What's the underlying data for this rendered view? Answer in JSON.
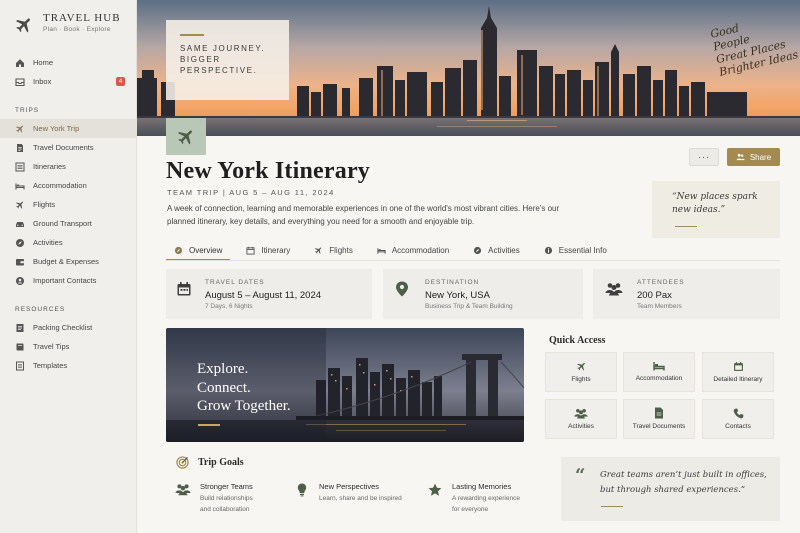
{
  "brand": {
    "title": "TRAVEL HUB",
    "subtitle": "Plan  ·  Book  ·  Explore"
  },
  "sidebar": {
    "top_items": [
      {
        "label": "Home",
        "icon": "home-icon"
      },
      {
        "label": "Inbox",
        "icon": "inbox-icon",
        "badge": "4"
      }
    ],
    "trips_label": "TRIPS",
    "trip_items": [
      {
        "label": "New York Trip",
        "icon": "plane-icon",
        "active": true
      },
      {
        "label": "Travel Documents",
        "icon": "document-icon"
      },
      {
        "label": "Itineraries",
        "icon": "list-icon"
      },
      {
        "label": "Accommodation",
        "icon": "bed-icon"
      },
      {
        "label": "Flights",
        "icon": "plane-icon"
      },
      {
        "label": "Ground Transport",
        "icon": "car-icon"
      },
      {
        "label": "Activities",
        "icon": "compass-icon"
      },
      {
        "label": "Budget & Expenses",
        "icon": "wallet-icon"
      },
      {
        "label": "Important Contacts",
        "icon": "person-icon"
      }
    ],
    "resources_label": "RESOURCES",
    "resource_items": [
      {
        "label": "Packing Checklist",
        "icon": "checklist-icon"
      },
      {
        "label": "Travel Tips",
        "icon": "book-icon"
      },
      {
        "label": "Templates",
        "icon": "template-icon"
      }
    ]
  },
  "hero": {
    "card_text": "SAME JOURNEY. BIGGER PERSPECTIVE.",
    "script_lines": [
      "Good",
      "People",
      "Great Places",
      "Brighter Ideas"
    ]
  },
  "header": {
    "title": "New York Itinerary",
    "subhead": "TEAM TRIP   |   AUG 5 – AUG 11, 2024",
    "description": "A week of connection, learning and memorable experiences in one of the world's most vibrant cities. Here's our planned itinerary, key details, and everything you need for a smooth and enjoyable trip.",
    "more_label": "···",
    "share_label": "Share",
    "quote": "“New places spark new ideas.”"
  },
  "tabs": [
    {
      "label": "Overview",
      "icon": "compass-icon",
      "active": true
    },
    {
      "label": "Itinerary",
      "icon": "calendar-icon"
    },
    {
      "label": "Flights",
      "icon": "plane-icon"
    },
    {
      "label": "Accommodation",
      "icon": "bed-icon"
    },
    {
      "label": "Activities",
      "icon": "compass-icon"
    },
    {
      "label": "Essential Info",
      "icon": "info-icon"
    }
  ],
  "info_cards": [
    {
      "label": "TRAVEL DATES",
      "value": "August 5 – August 11, 2024",
      "detail": "7 Days, 6 Nights",
      "icon": "calendar-icon"
    },
    {
      "label": "DESTINATION",
      "value": "New York, USA",
      "detail": "Business Trip & Team Building",
      "icon": "map-pin-icon"
    },
    {
      "label": "ATTENDEES",
      "value": "200 Pax",
      "detail": "Team Members",
      "icon": "people-icon"
    }
  ],
  "feature": {
    "lines": [
      "Explore.",
      "Connect.",
      "Grow Together."
    ]
  },
  "quick_access": {
    "title": "Quick Access",
    "tiles": [
      {
        "label": "Flights",
        "icon": "plane-icon"
      },
      {
        "label": "Accommodation",
        "icon": "bed-icon"
      },
      {
        "label": "Detailed Itinerary",
        "icon": "calendar-icon"
      },
      {
        "label": "Activities",
        "icon": "people-icon"
      },
      {
        "label": "Travel Documents",
        "icon": "document-icon"
      },
      {
        "label": "Contacts",
        "icon": "phone-icon"
      }
    ]
  },
  "goals": {
    "title": "Trip Goals",
    "items": [
      {
        "title": "Stronger Teams",
        "line1": "Build relationships",
        "line2": "and collaboration",
        "icon": "people-icon"
      },
      {
        "title": "New Perspectives",
        "line1": "Learn, share and be inspired",
        "line2": "",
        "icon": "lightbulb-icon"
      },
      {
        "title": "Lasting Memories",
        "line1": "A rewarding experience",
        "line2": "for everyone",
        "icon": "star-icon"
      }
    ]
  },
  "footer_quote": "Great teams aren’t just built in offices, but through shared experiences.”",
  "colors": {
    "accent": "#a28a51",
    "icon_green": "#4d5f49",
    "sidebar_bg": "#f1efeb"
  }
}
